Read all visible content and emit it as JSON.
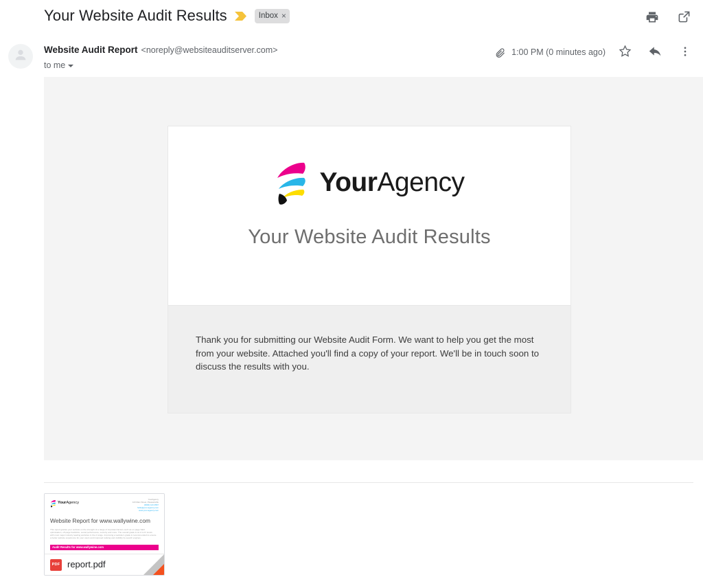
{
  "header": {
    "subject": "Your Website Audit Results",
    "important_marker_icon": "important-marker-icon",
    "label": "Inbox",
    "label_remove": "×",
    "print_icon": "print-icon",
    "open_in_new_icon": "open-in-new-window-icon"
  },
  "sender": {
    "avatar_icon": "default-avatar-icon",
    "name": "Website Audit Report",
    "email": "<noreply@websiteauditserver.com>",
    "recipient": "to me",
    "recipient_caret_icon": "chevron-down-icon",
    "attachment_indicator_icon": "paperclip-icon",
    "timestamp": "1:00 PM (0 minutes ago)",
    "star_icon": "star-icon",
    "reply_icon": "reply-icon",
    "more_icon": "more-vertical-icon"
  },
  "email": {
    "logo_mark_icon": "youragency-logo-mark",
    "logo_bold": "Your",
    "logo_light": "Agency",
    "headline": "Your Website Audit Results",
    "body": "Thank you for submitting our Website Audit Form. We want to help you get the most from your website. Attached you'll find a copy of your report. We'll be in touch soon to discuss the results with you."
  },
  "colors": {
    "logo_magenta": "#ec008c",
    "logo_cyan": "#29b6e8",
    "logo_yellow": "#fddd00",
    "logo_black": "#111111",
    "pdf_red": "#e8403a",
    "fold_orange": "#f4511e",
    "body_background": "#f4f4f4",
    "panel_background": "#efefef"
  },
  "attachment": {
    "filename": "report.pdf",
    "filetype_badge": "PDF",
    "filetype_icon": "pdf-file-icon",
    "thumbnail": {
      "logo_bold": "Your",
      "logo_light": "Agency",
      "address_lines": [
        "YourAgency",
        "123 Main Street, Pleasantville",
        "(0000) 123 4567",
        "hello@your-agency.com",
        "www.your-agency.com"
      ],
      "title": "Website Report for www.wallywine.com",
      "paragraph_lines": [
        "This report grades your website on the strength of a range of important factors such as on-page SEO",
        "optimisation, off-page backlinks, social performance, security and more. The overall grade is an A to F/ levels",
        "with most major industry leading websites in the A range. Improving a website's grade is recommended to ensure",
        "a better website experience for your users and improved ranking and visibility by search engines."
      ],
      "banner": "Audit Results for www.wallywine.com"
    }
  }
}
